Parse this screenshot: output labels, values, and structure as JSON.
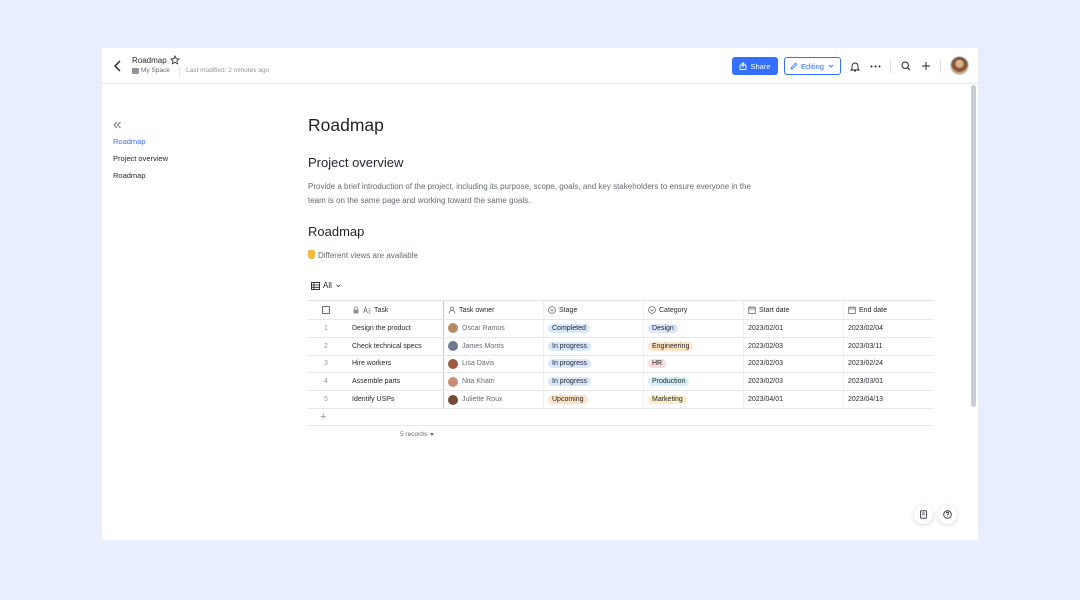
{
  "header": {
    "title": "Roadmap",
    "space": "My Space",
    "last_modified": "Last modified: 2 minutes ago",
    "share_label": "Share",
    "editing_label": "Editing"
  },
  "toc": {
    "items": [
      {
        "label": "Roadmap",
        "active": true
      },
      {
        "label": "Project overview",
        "active": false
      },
      {
        "label": "Roadmap",
        "active": false
      }
    ]
  },
  "doc": {
    "title": "Roadmap",
    "section1_heading": "Project overview",
    "section1_body": "Provide a brief introduction of the project, including its purpose, scope, goals, and key stakeholders to ensure everyone in the team is on the same page and working toward the same goals.",
    "section2_heading": "Roadmap",
    "callout": "Different views are available",
    "view_label": "All"
  },
  "table": {
    "columns": [
      "Task",
      "Task owner",
      "Stage",
      "Category",
      "Start date",
      "End date"
    ],
    "rows": [
      {
        "num": "1",
        "task": "Design the product",
        "owner": "Oscar Ramos",
        "stage": "Completed",
        "category": "Design",
        "start": "2023/02/01",
        "end": "2023/02/04"
      },
      {
        "num": "2",
        "task": "Check technical specs",
        "owner": "James Morris",
        "stage": "In progress",
        "category": "Engineering",
        "start": "2023/02/03",
        "end": "2023/03/11"
      },
      {
        "num": "3",
        "task": "Hire workers",
        "owner": "Lisa Davis",
        "stage": "In progress",
        "category": "HR",
        "start": "2023/02/03",
        "end": "2023/02/24"
      },
      {
        "num": "4",
        "task": "Assemble parts",
        "owner": "Nita Khatri",
        "stage": "In progress",
        "category": "Production",
        "start": "2023/02/03",
        "end": "2023/03/01"
      },
      {
        "num": "5",
        "task": "Identify USPs",
        "owner": "Juliette Roux",
        "stage": "Upcoming",
        "category": "Marketing",
        "start": "2023/04/01",
        "end": "2023/04/13"
      }
    ],
    "add_row_label": "+",
    "records_label": "5 records"
  },
  "colors": {
    "accent": "#3370ff",
    "tag_completed": "#d9e7fd",
    "tag_in_progress": "#d9e7fd",
    "tag_upcoming": "#fde2c3",
    "tag_design": "#dbe4fb",
    "tag_engineering": "#fde2c3",
    "tag_hr": "#fcdbdb",
    "tag_production": "#d5f0f8",
    "tag_marketing": "#fdeec5"
  }
}
